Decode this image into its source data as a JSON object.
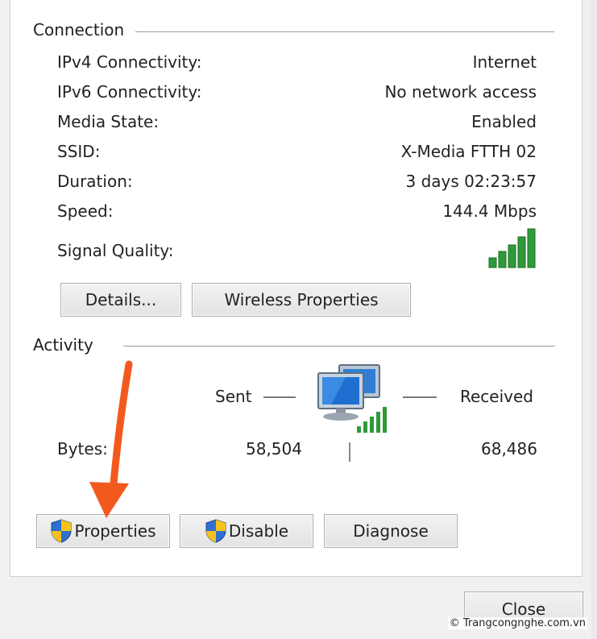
{
  "connection": {
    "title": "Connection",
    "rows": [
      {
        "label": "IPv4 Connectivity:",
        "value": "Internet"
      },
      {
        "label": "IPv6 Connectivity:",
        "value": "No network access"
      },
      {
        "label": "Media State:",
        "value": "Enabled"
      },
      {
        "label": "SSID:",
        "value": "X-Media FTTH 02"
      },
      {
        "label": "Duration:",
        "value": "3 days 02:23:57"
      },
      {
        "label": "Speed:",
        "value": "144.4 Mbps"
      }
    ],
    "signal_label": "Signal Quality:",
    "signal_bars_lit": 5,
    "signal_bars_total": 5,
    "details_button": "Details...",
    "wireless_button": "Wireless Properties"
  },
  "activity": {
    "title": "Activity",
    "sent_label": "Sent",
    "received_label": "Received",
    "bytes_label": "Bytes:",
    "bytes_sent": "58,504",
    "bytes_received": "68,486",
    "properties_button": "Properties",
    "disable_button": "Disable",
    "diagnose_button": "Diagnose"
  },
  "footer": {
    "close_button": "Close"
  },
  "watermark": "© Trangcongnghe.com.vn",
  "colors": {
    "signal_green": "#2e9a3a",
    "arrow_orange": "#f25a1d",
    "shield_blue": "#2f6fcf",
    "shield_yellow": "#f4c21a"
  }
}
